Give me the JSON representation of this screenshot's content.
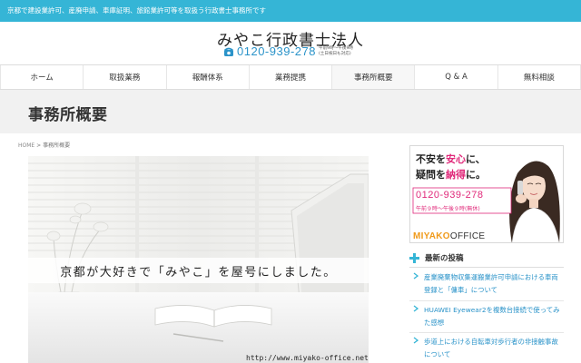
{
  "topbar": {
    "tagline": "京都で建設業許可、産廃申請、車庫証明、旅館業許可等を取扱う行政書士事務所です"
  },
  "header": {
    "site_title": "みやこ行政書士法人",
    "phone_icon": "phone-icon",
    "phone_number": "0120-939-278",
    "hours_line1": "午前9時〜午後9時",
    "hours_line2": "(土日祝日も対応)"
  },
  "nav": {
    "items": [
      {
        "label": "ホーム"
      },
      {
        "label": "取扱業務"
      },
      {
        "label": "報酬体系"
      },
      {
        "label": "業務提携"
      },
      {
        "label": "事務所概要",
        "active": true
      },
      {
        "label": "Q & A"
      },
      {
        "label": "無料相談"
      }
    ]
  },
  "page": {
    "title": "事務所概要",
    "breadcrumb_home": "HOME",
    "breadcrumb_sep": ">",
    "breadcrumb_current": "事務所概要"
  },
  "hero": {
    "caption": "京都が大好きで「みやこ」を屋号にしました。",
    "url": "http://www.miyako-office.net"
  },
  "banner": {
    "line1_pre": "不安を",
    "line1_accent": "安心",
    "line1_post": "に、",
    "line2_pre": "疑問を",
    "line2_accent": "納得",
    "line2_post": "に。",
    "phone": "0120-939-278",
    "hours": "午前９時〜午後９時(無休)",
    "brand_part1": "MIYAKO",
    "brand_part2": "OFFICE",
    "accent_color": "#e0297a",
    "brand_color": "#f09a1a"
  },
  "sidebar": {
    "recent_heading": "最新の投稿",
    "heading_icon": "plus-icon",
    "posts": [
      {
        "title": "産業廃棄物収集運搬業許可申請における車両登録と「傭車」について"
      },
      {
        "title": "HUAWEI Eyewear2を複数台接続で使ってみた感想"
      },
      {
        "title": "歩道上における自転車対歩行者の非接触事故について"
      }
    ]
  },
  "colors": {
    "topbar": "#35b5d6",
    "link": "#2a93c9",
    "title_band": "#f1f1f1"
  }
}
